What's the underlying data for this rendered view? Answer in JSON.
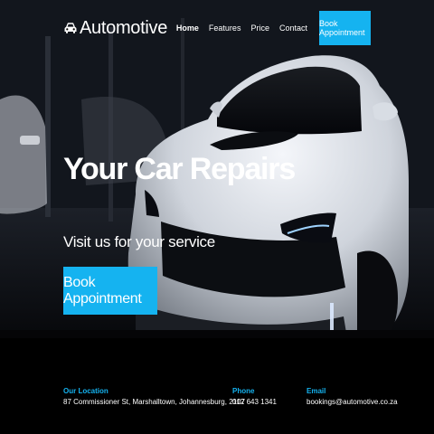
{
  "brand": {
    "name": "Automotive",
    "icon": "car-icon"
  },
  "nav": {
    "items": [
      {
        "label": "Home",
        "active": true
      },
      {
        "label": "Features",
        "active": false
      },
      {
        "label": "Price",
        "active": false
      },
      {
        "label": "Contact",
        "active": false
      }
    ],
    "cta_label": "Book Appointment"
  },
  "hero": {
    "title": "Your Car Repairs",
    "subtitle": "Visit us for your service",
    "button_label": "Book Appointment"
  },
  "footer": {
    "location": {
      "label": "Our Location",
      "value": "87 Commissioner St, Marshalltown, Johannesburg, 2107"
    },
    "phone": {
      "label": "Phone",
      "value": "012 643 1341"
    },
    "email": {
      "label": "Email",
      "value": "bookings@automotive.co.za"
    }
  },
  "colors": {
    "accent": "#15b3f0",
    "footer_bg": "#000000",
    "text": "#ffffff"
  }
}
